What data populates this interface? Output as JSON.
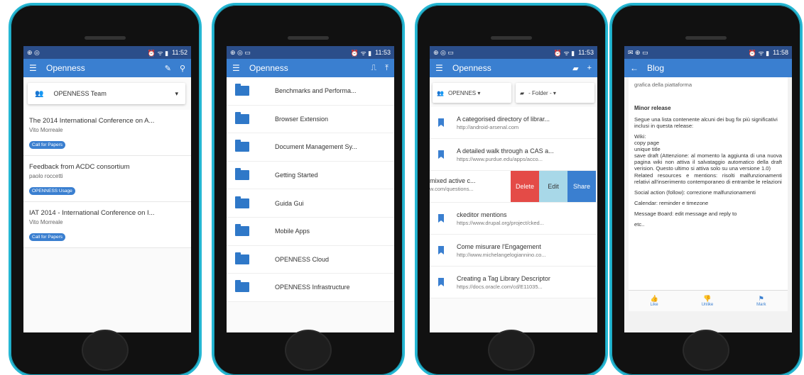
{
  "phone1": {
    "status": {
      "left_icons": "⊕ ◎",
      "right": "11:52"
    },
    "appbar": {
      "title": "Openness"
    },
    "team": {
      "label": "OPENNESS Team"
    },
    "posts": [
      {
        "title": "The 2014 International Conference on A...",
        "author": "Vito Morreale",
        "tag": "Call for Papers"
      },
      {
        "title": "Feedback from ACDC consortium",
        "author": "paolo roccetti",
        "tag": "OPENNESS Usage"
      },
      {
        "title": "IAT 2014 - International Conference on I...",
        "author": "Vito Morreale",
        "tag": "Call for Papers"
      }
    ]
  },
  "phone2": {
    "status": {
      "left_icons": "⊕ ◎ ▭",
      "right": "11:53"
    },
    "appbar": {
      "title": "Openness"
    },
    "folders": [
      "Benchmarks and Performa...",
      "Browser Extension",
      "Document Management Sy...",
      "Getting Started",
      "Guida Gui",
      "Mobile Apps",
      "OPENNESS Cloud",
      "OPENNESS Infrastructure"
    ]
  },
  "phone3": {
    "status": {
      "left_icons": "⊕ ◎ ▭",
      "right": "11:53"
    },
    "appbar": {
      "title": "Openness"
    },
    "filters": {
      "team": "OPENNES ▾",
      "folder": "- Folder - ▾"
    },
    "links": [
      {
        "title": "A categorised directory of librar...",
        "url": "http://android-arsenal.com"
      },
      {
        "title": "A detailed walk through a CAS a...",
        "url": "https://www.purdue.edu/apps/acco..."
      }
    ],
    "swiped": {
      "title": "mixed active c...",
      "url": "w.com/questions...",
      "delete": "Delete",
      "edit": "Edit",
      "share": "Share"
    },
    "links2": [
      {
        "title": "ckeditor mentions",
        "url": "https://www.drupal.org/project/cked..."
      },
      {
        "title": "Come misurare l'Engagement",
        "url": "http://www.michelangelogiannino.co..."
      },
      {
        "title": "Creating a Tag Library Descriptor",
        "url": "https://docs.oracle.com/cd/E11035..."
      }
    ]
  },
  "phone4": {
    "status": {
      "left_icons": "✉ ⊕ ▭",
      "right": "11:58"
    },
    "appbar": {
      "title": "Blog"
    },
    "intro": "grafica della piattaforma",
    "heading": "Minor release",
    "p1": "Segue una lista contenente alcuni dei bug fix più significativi inclusi in questa release:",
    "p2": "Wiki:\ncopy page\nunique title\nsave draft (Attenzione: al momento la aggiunta di una nuova pagina wiki non attiva il salvataggio automatico della draft verision. Questo ultimo si attiva solo su una versione 1.0)\nRelated resources e mentions: risolti malfunzionamenti relativi all'inserimento contemporaneo di entrambe le relazioni",
    "p3": "Social action (follow): correzione malfunzionamenti",
    "p4": "Calendar: reminder e timezone",
    "p5": "Message Board: edit message and reply to",
    "p6": "etc..",
    "actions": {
      "like": "Like",
      "unlike": "Unlike",
      "mark": "Mark"
    }
  }
}
